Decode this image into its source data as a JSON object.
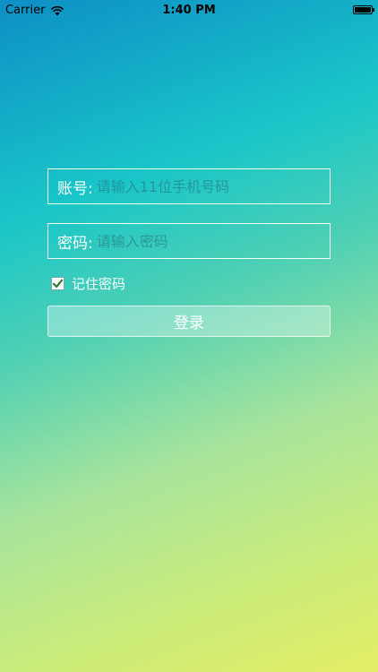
{
  "status_bar": {
    "carrier": "Carrier",
    "time": "1:40 PM",
    "wifi_icon": "wifi-icon",
    "battery_icon": "battery-icon",
    "battery_level": 1.0
  },
  "login_form": {
    "account": {
      "label": "账号:",
      "placeholder": "请输入11位手机号码",
      "value": ""
    },
    "password": {
      "label": "密码:",
      "placeholder": "请输入密码",
      "value": ""
    },
    "remember_password": {
      "label": "记住密码",
      "checked": true,
      "icon": "checkmark-icon"
    },
    "submit_label": "登录"
  },
  "colors": {
    "gradient_top": "#0e8fc6",
    "gradient_mid": "#4fd0b4",
    "gradient_bottom": "#e4ee66",
    "checkmark": "#2e7d32"
  }
}
